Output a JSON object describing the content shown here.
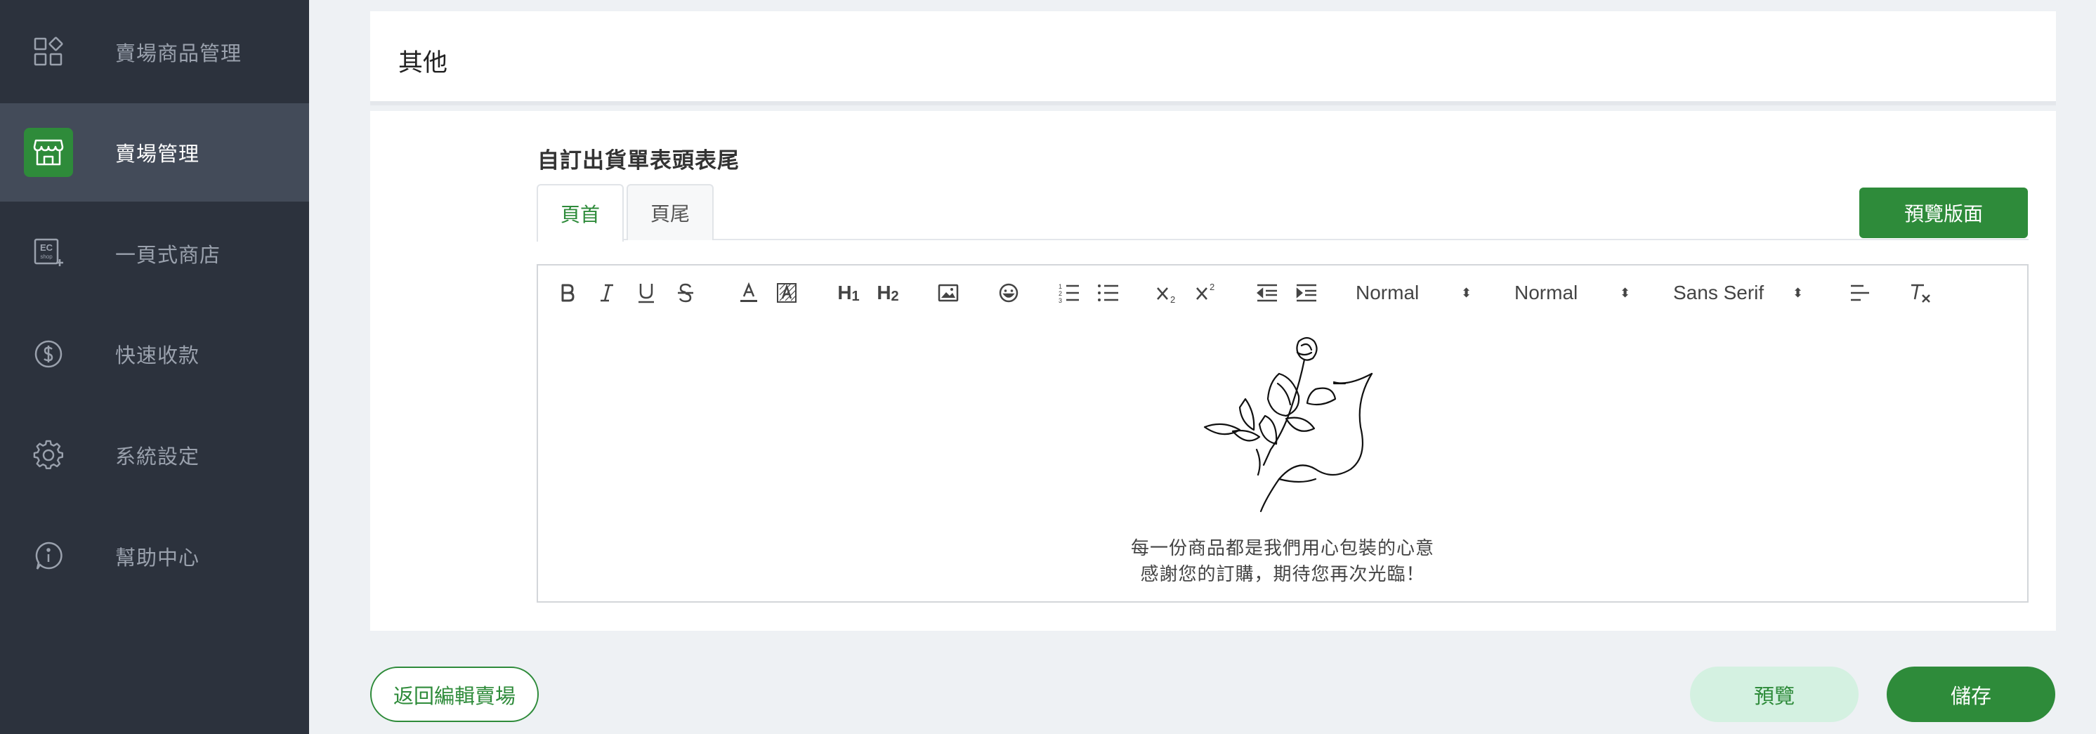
{
  "sidebar": {
    "items": [
      {
        "label": "賣場商品管理",
        "icon": "grid-shapes-icon"
      },
      {
        "label": "賣場管理",
        "icon": "storefront-icon"
      },
      {
        "label": "一頁式商店",
        "icon": "ec-shop-icon"
      },
      {
        "label": "快速收款",
        "icon": "dollar-circle-icon"
      },
      {
        "label": "系統設定",
        "icon": "gear-icon"
      },
      {
        "label": "幫助中心",
        "icon": "info-bubble-icon"
      }
    ],
    "ec_icon_top": "EC",
    "ec_icon_bottom": "shop"
  },
  "top_card": {
    "title": "其他"
  },
  "section": {
    "title": "自訂出貨單表頭表尾"
  },
  "tabs": [
    {
      "label": "頁首"
    },
    {
      "label": "頁尾"
    }
  ],
  "preview_layout_button": "預覽版面",
  "toolbar": {
    "header_select": "Normal",
    "size_select": "Normal",
    "font_select": "Sans Serif",
    "h1": "H",
    "h2": "H"
  },
  "editor": {
    "line1": "每一份商品都是我們用心包裝的心意",
    "line2": "感謝您的訂購，期待您再次光臨！"
  },
  "buttons": {
    "back": "返回編輯賣場",
    "preview": "預覽",
    "save": "儲存"
  },
  "colors": {
    "accent": "#2e8b3a",
    "sidebar": "#2c323d",
    "preview_bg": "#d4f1e1"
  }
}
